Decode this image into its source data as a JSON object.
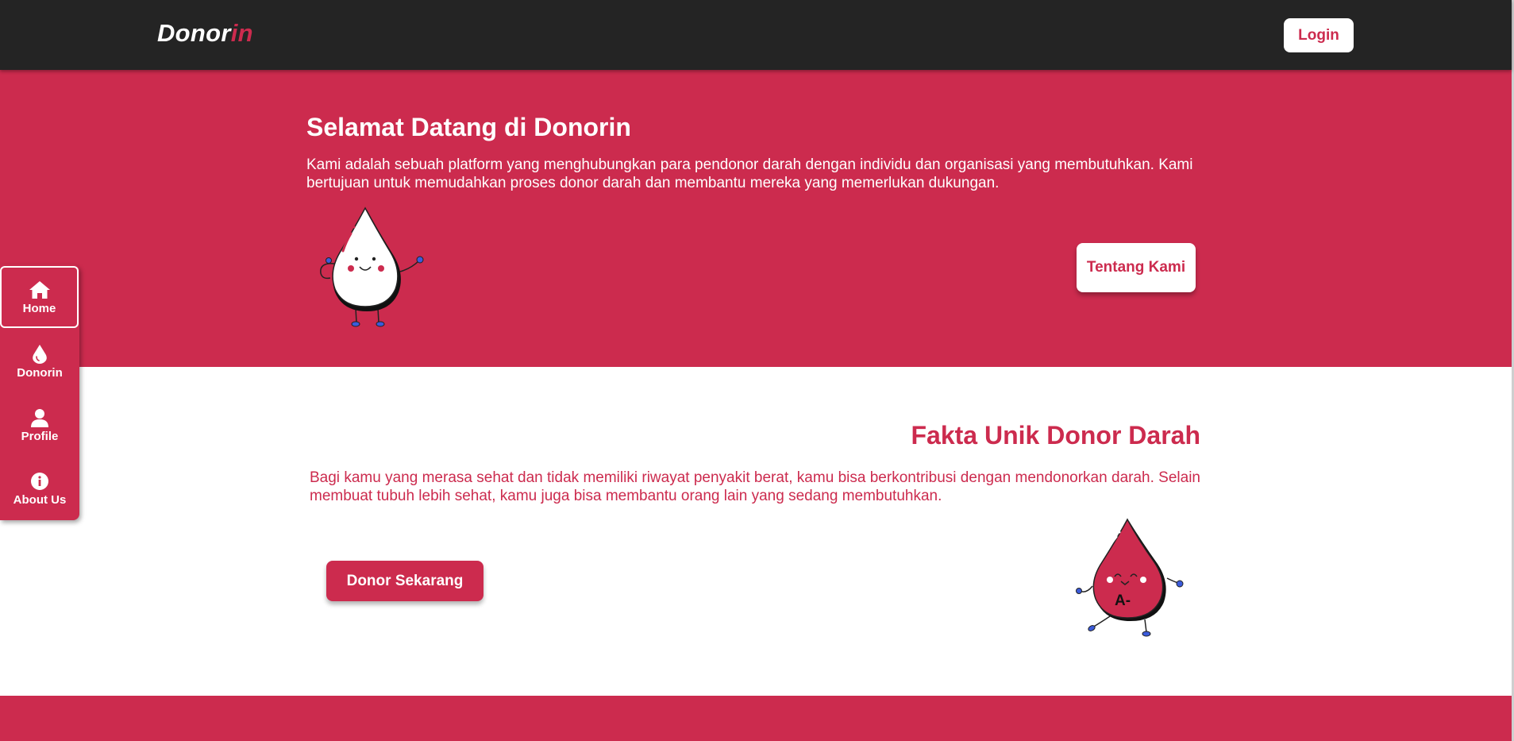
{
  "header": {
    "brand_main": "Donor",
    "brand_accent": "in",
    "login_label": "Login"
  },
  "sidebar": {
    "items": [
      {
        "label": "Home",
        "icon": "home-icon",
        "active": true
      },
      {
        "label": "Donorin",
        "icon": "blood-drop-icon",
        "active": false
      },
      {
        "label": "Profile",
        "icon": "user-icon",
        "active": false
      },
      {
        "label": "About Us",
        "icon": "info-icon",
        "active": false
      }
    ]
  },
  "hero": {
    "title": "Selamat Datang di Donorin",
    "text": "Kami adalah sebuah platform yang menghubungkan para pendonor darah dengan individu dan organisasi yang membutuhkan. Kami bertujuan untuk memudahkan proses donor darah dan membantu mereka yang memerlukan dukungan.",
    "button_label": "Tentang Kami"
  },
  "facts": {
    "title": "Fakta Unik Donor Darah",
    "text": "Bagi kamu yang merasa sehat dan tidak memiliki riwayat penyakit berat, kamu bisa berkontribusi dengan mendonorkan darah. Selain membuat tubuh lebih sehat, kamu juga bisa membantu orang lain yang sedang membutuhkan.",
    "button_label": "Donor Sekarang",
    "mascot_label": "A-"
  },
  "colors": {
    "brand": "#cc2b4e",
    "header_bg": "#242424",
    "white": "#ffffff"
  }
}
